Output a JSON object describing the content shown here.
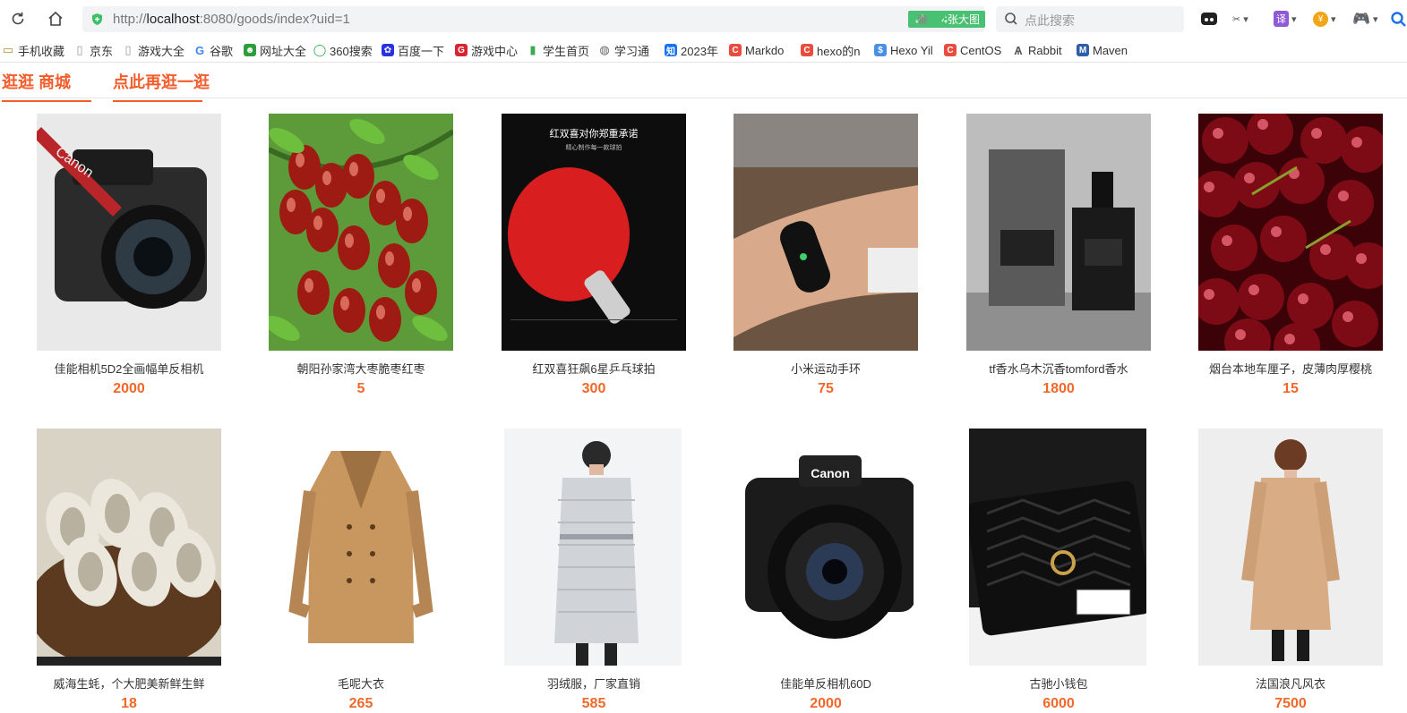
{
  "browser": {
    "url_prefix": "http://",
    "url_host": "localhost",
    "url_rest": ":8080/goods/index?uid=1",
    "big_image_label": "4张大图",
    "search_placeholder": "点此搜索"
  },
  "bookmarks": [
    {
      "label": "手机收藏夹",
      "icon": "folder-icon",
      "color": "#b58f3a"
    },
    {
      "label": "京东",
      "icon": "page-icon",
      "color": "#999999"
    },
    {
      "label": "游戏大全",
      "icon": "page-icon",
      "color": "#999999"
    },
    {
      "label": "谷歌",
      "icon": "google-icon",
      "color": "#4285f4"
    },
    {
      "label": "网址大全",
      "icon": "hao360-icon",
      "color": "#2e9e3c"
    },
    {
      "label": "360搜索",
      "icon": "so360-icon",
      "color": "#2aa84a"
    },
    {
      "label": "百度一下",
      "icon": "baidu-icon",
      "color": "#2932e1"
    },
    {
      "label": "游戏中心",
      "icon": "game-icon",
      "color": "#d9232e"
    },
    {
      "label": "学生首页",
      "icon": "chart-icon",
      "color": "#3ea84f"
    },
    {
      "label": "学习通",
      "icon": "globe-icon",
      "color": "#666666"
    },
    {
      "label": "2023年",
      "icon": "zhihu-icon",
      "color": "#1772f6"
    },
    {
      "label": "Markdo",
      "icon": "csdn-icon",
      "color": "#e84c3d"
    },
    {
      "label": "hexo的n",
      "icon": "csdn-icon",
      "color": "#e84c3d"
    },
    {
      "label": "Hexo Yil",
      "icon": "hexo-icon",
      "color": "#4a90e2"
    },
    {
      "label": "CentOS",
      "icon": "csdn-icon",
      "color": "#e84c3d"
    },
    {
      "label": "Rabbit",
      "icon": "rabbit-icon",
      "color": "#555555"
    },
    {
      "label": "Maven",
      "icon": "maven-icon",
      "color": "#2d5fa8"
    }
  ],
  "store": {
    "home_link": "逛逛 商城",
    "again_link": "点此再逛一逛"
  },
  "goods": [
    {
      "name": "佳能相机5D2全画幅单反相机",
      "price": "2000",
      "image": "canon-5d2-camera"
    },
    {
      "name": "朝阳孙家湾大枣脆枣红枣",
      "price": "5",
      "image": "red-jujube"
    },
    {
      "name": "红双喜狂飙6星乒乓球拍",
      "price": "300",
      "image": "ping-pong-paddle"
    },
    {
      "name": "小米运动手环",
      "price": "75",
      "image": "mi-band"
    },
    {
      "name": "tf香水乌木沉香tomford香水",
      "price": "1800",
      "image": "tomford-perfume"
    },
    {
      "name": "烟台本地车厘子，皮薄肉厚樱桃",
      "price": "15",
      "image": "cherries"
    },
    {
      "name": "威海生蚝，个大肥美新鲜生鲜",
      "price": "18",
      "image": "oysters"
    },
    {
      "name": "毛呢大衣",
      "price": "265",
      "image": "wool-coat"
    },
    {
      "name": "羽绒服，厂家直销",
      "price": "585",
      "image": "down-jacket"
    },
    {
      "name": "佳能单反相机60D",
      "price": "2000",
      "image": "canon-60d-camera"
    },
    {
      "name": "古驰小钱包",
      "price": "6000",
      "image": "gucci-wallet"
    },
    {
      "name": "法国浪凡风衣",
      "price": "7500",
      "image": "trench-coat"
    }
  ]
}
